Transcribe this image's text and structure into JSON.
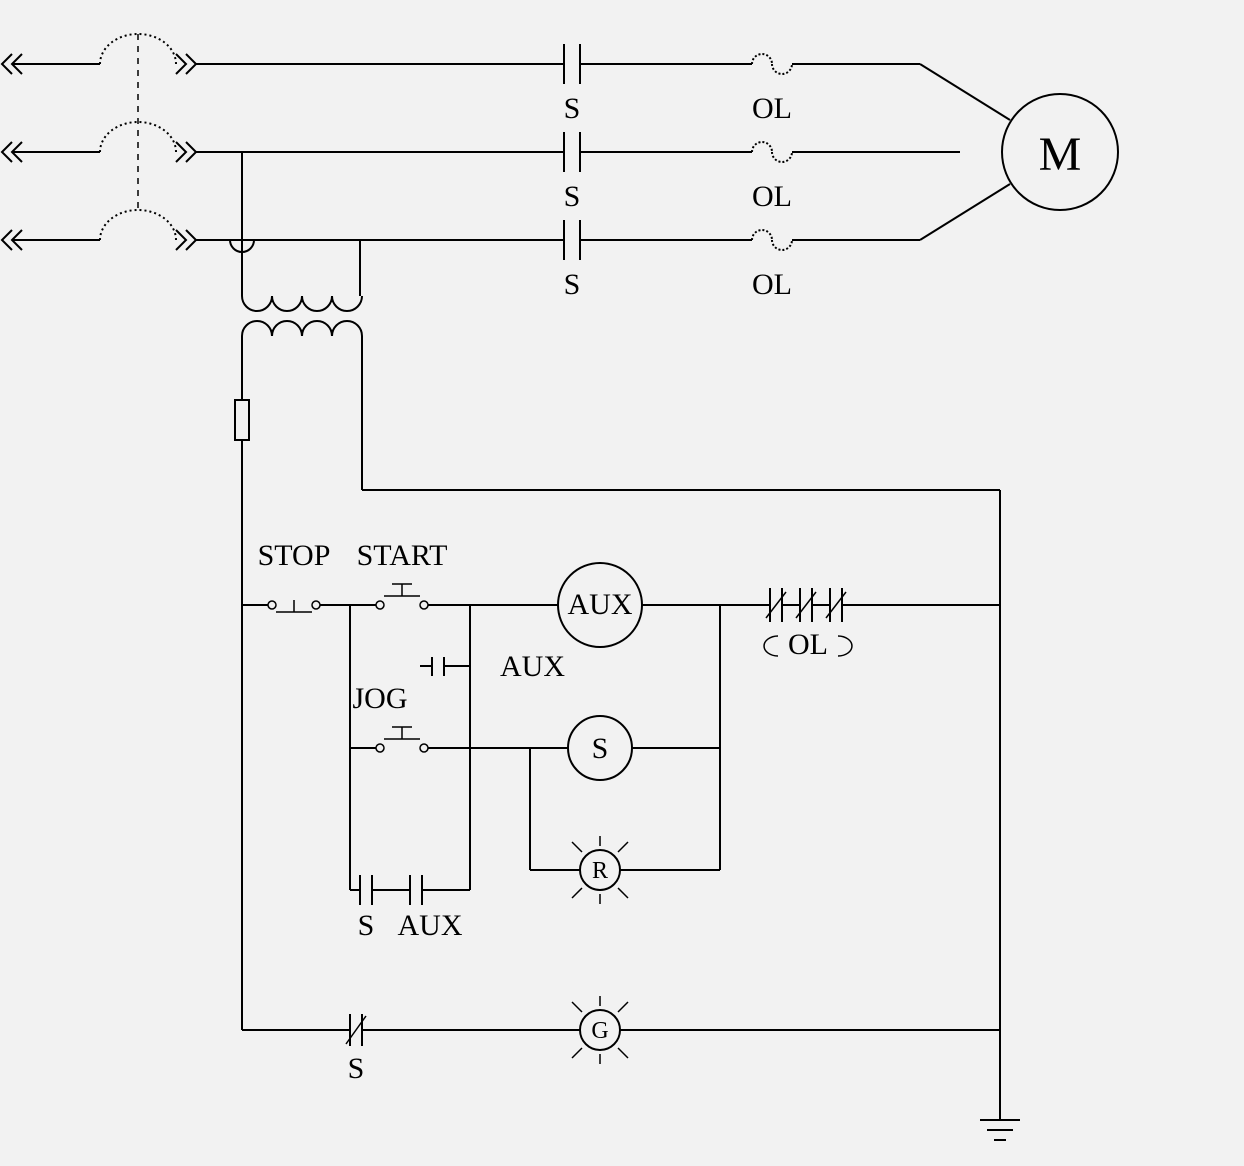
{
  "labels": {
    "S1": "S",
    "S2": "S",
    "S3": "S",
    "OL1": "OL",
    "OL2": "OL",
    "OL3": "OL",
    "M": "M",
    "STOP": "STOP",
    "START": "START",
    "JOG": "JOG",
    "AUX_coil": "AUX",
    "AUX_contact": "AUX",
    "S_coil": "S",
    "R_lamp": "R",
    "G_lamp": "G",
    "S_seal": "S",
    "AUX_seal": "AUX",
    "OL_ctrl": "OL",
    "S_nc": "S"
  }
}
